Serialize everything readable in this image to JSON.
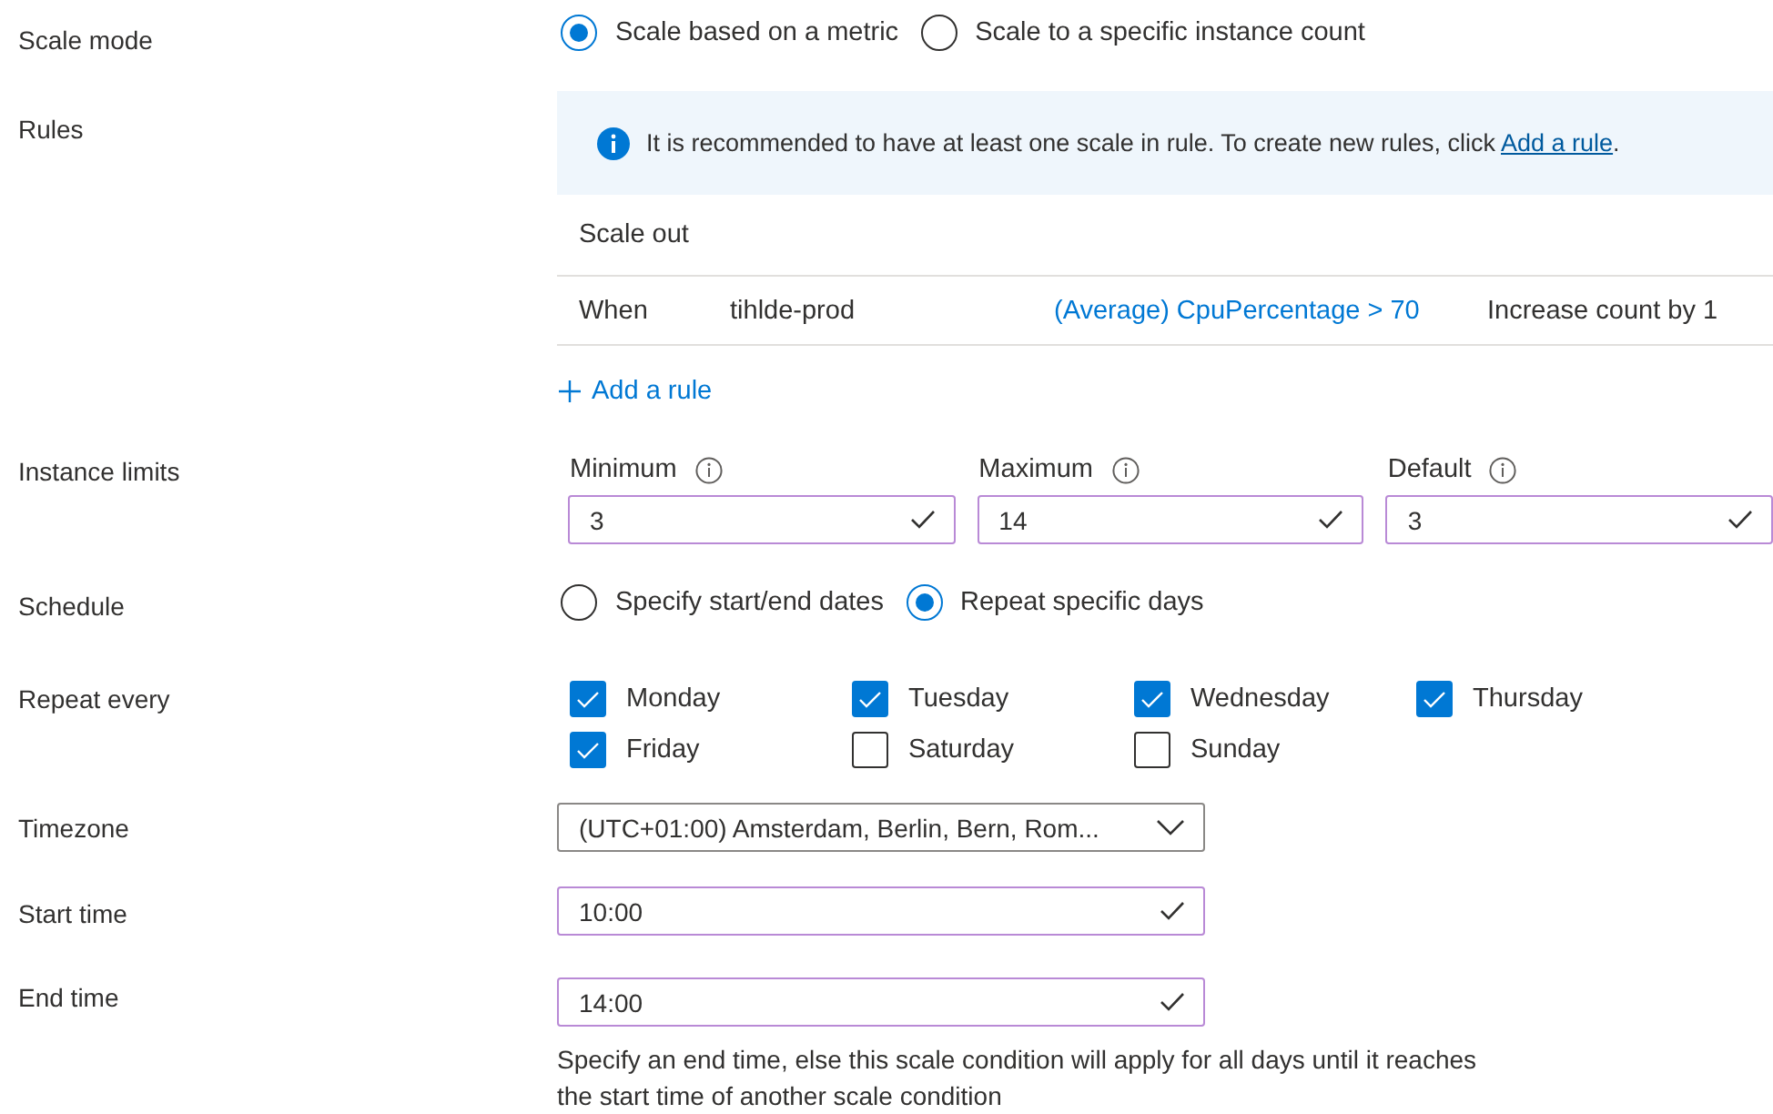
{
  "scale_mode": {
    "label": "Scale mode",
    "options": [
      {
        "label": "Scale based on a metric",
        "selected": true
      },
      {
        "label": "Scale to a specific instance count",
        "selected": false
      }
    ]
  },
  "rules": {
    "label": "Rules",
    "info_before": "It is recommended to have at least one scale in rule. To create new rules, click ",
    "info_link": "Add a rule",
    "info_after": ".",
    "section": "Scale out",
    "rows": [
      {
        "column_1": "When",
        "column_2": "tihlde-prod",
        "column_3": "(Average) CpuPercentage > 70",
        "column_4": "Increase count by 1"
      }
    ],
    "add_rule": "Add a rule"
  },
  "instance_limits": {
    "label": "Instance limits",
    "fields": [
      {
        "label": "Minimum",
        "value": "3"
      },
      {
        "label": "Maximum",
        "value": "14"
      },
      {
        "label": "Default",
        "value": "3"
      }
    ]
  },
  "schedule": {
    "label": "Schedule",
    "options": [
      {
        "label": "Specify start/end dates",
        "selected": false
      },
      {
        "label": "Repeat specific days",
        "selected": true
      }
    ]
  },
  "repeat_every": {
    "label": "Repeat every",
    "days": [
      {
        "label": "Monday",
        "checked": true
      },
      {
        "label": "Tuesday",
        "checked": true
      },
      {
        "label": "Wednesday",
        "checked": true
      },
      {
        "label": "Thursday",
        "checked": true
      },
      {
        "label": "Friday",
        "checked": true
      },
      {
        "label": "Saturday",
        "checked": false
      },
      {
        "label": "Sunday",
        "checked": false
      }
    ]
  },
  "timezone": {
    "label": "Timezone",
    "value": "(UTC+01:00) Amsterdam, Berlin, Bern, Rom..."
  },
  "start_time": {
    "label": "Start time",
    "value": "10:00"
  },
  "end_time": {
    "label": "End time",
    "value": "14:00",
    "help": "Specify an end time, else this scale condition will apply for all days until it reaches the start time of another scale condition"
  }
}
